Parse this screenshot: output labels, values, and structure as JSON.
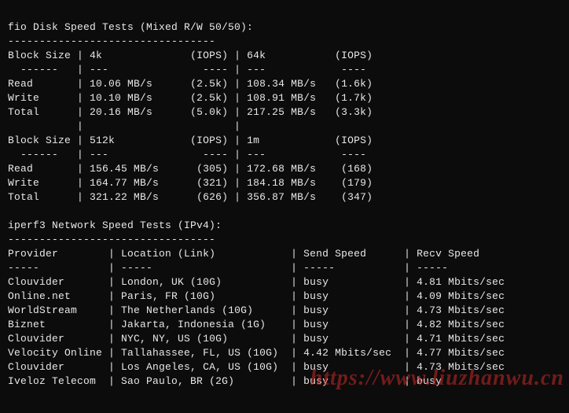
{
  "fio": {
    "title": "fio Disk Speed Tests (Mixed R/W 50/50):",
    "dash_line": "---------------------------------",
    "hdr_block": "Block Size",
    "hdr_iops": "(IOPS)",
    "hdr_sub1": "  ------",
    "hdr_sub2": "---",
    "hdr_sub3": "----",
    "hdr_sub4": "---- ",
    "row_read": "Read",
    "row_write": "Write",
    "row_total": "Total",
    "block1": {
      "colA": "4k",
      "colB": "64k",
      "read": {
        "a_val": "10.06 MB/s",
        "a_iops": "(2.5k)",
        "b_val": "108.34 MB/s",
        "b_iops": "(1.6k)"
      },
      "write": {
        "a_val": "10.10 MB/s",
        "a_iops": "(2.5k)",
        "b_val": "108.91 MB/s",
        "b_iops": "(1.7k)"
      },
      "total": {
        "a_val": "20.16 MB/s",
        "a_iops": "(5.0k)",
        "b_val": "217.25 MB/s",
        "b_iops": "(3.3k)"
      }
    },
    "block2": {
      "colA": "512k",
      "colB": "1m",
      "read": {
        "a_val": "156.45 MB/s",
        "a_iops": "(305)",
        "b_val": "172.68 MB/s",
        "b_iops": "(168)"
      },
      "write": {
        "a_val": "164.77 MB/s",
        "a_iops": "(321)",
        "b_val": "184.18 MB/s",
        "b_iops": "(179)"
      },
      "total": {
        "a_val": "321.22 MB/s",
        "a_iops": "(626)",
        "b_val": "356.87 MB/s",
        "b_iops": "(347)"
      }
    }
  },
  "iperf": {
    "title": "iperf3 Network Speed Tests (IPv4):",
    "dash_line": "---------------------------------",
    "hdr_provider": "Provider",
    "hdr_location": "Location (Link)",
    "hdr_send": "Send Speed",
    "hdr_recv": "Recv Speed",
    "hdr_sub": "-----",
    "rows": [
      {
        "provider": "Clouvider",
        "location": "London, UK (10G)",
        "send": "busy",
        "recv": "4.81 Mbits/sec"
      },
      {
        "provider": "Online.net",
        "location": "Paris, FR (10G)",
        "send": "busy",
        "recv": "4.09 Mbits/sec"
      },
      {
        "provider": "WorldStream",
        "location": "The Netherlands (10G)",
        "send": "busy",
        "recv": "4.73 Mbits/sec"
      },
      {
        "provider": "Biznet",
        "location": "Jakarta, Indonesia (1G)",
        "send": "busy",
        "recv": "4.82 Mbits/sec"
      },
      {
        "provider": "Clouvider",
        "location": "NYC, NY, US (10G)",
        "send": "busy",
        "recv": "4.71 Mbits/sec"
      },
      {
        "provider": "Velocity Online",
        "location": "Tallahassee, FL, US (10G)",
        "send": "4.42 Mbits/sec",
        "recv": "4.77 Mbits/sec"
      },
      {
        "provider": "Clouvider",
        "location": "Los Angeles, CA, US (10G)",
        "send": "busy",
        "recv": "4.73 Mbits/sec"
      },
      {
        "provider": "Iveloz Telecom",
        "location": "Sao Paulo, BR (2G)",
        "send": "busy",
        "recv": "busy"
      }
    ]
  },
  "watermark": "https://www.liuzhanwu.cn"
}
